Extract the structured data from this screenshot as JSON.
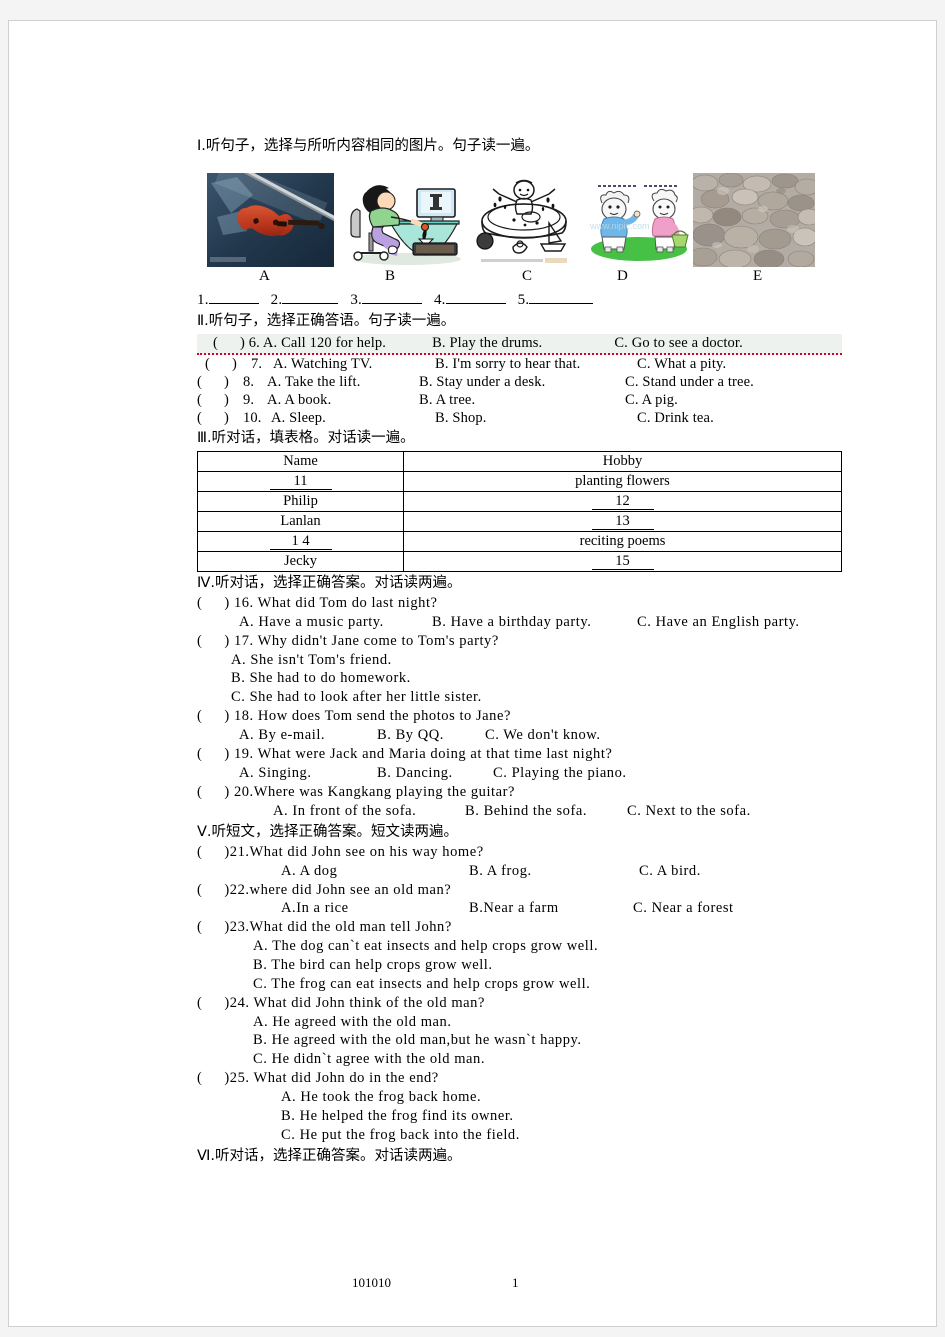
{
  "document": {
    "footer_code": "101010",
    "page_number": "1"
  },
  "sections": {
    "s1": {
      "heading": "Ⅰ.听句子，选择与所听内容相同的图片。句子读一遍。",
      "pictures": [
        {
          "label": "A",
          "alt": "red violin with bow on dark blue background"
        },
        {
          "label": "B",
          "alt": "cartoon girl sitting at a computer desk"
        },
        {
          "label": "C",
          "alt": "line drawing of a child in a swimming pool with ball and toy boat"
        },
        {
          "label": "D",
          "alt": "two cartoon goats on grass, one with a basket"
        },
        {
          "label": "E",
          "alt": "photograph of gray and brown stones"
        }
      ],
      "blanks": [
        "1.",
        "2.",
        "3.",
        "4.",
        "5."
      ]
    },
    "s2": {
      "heading": "Ⅱ.听句子，选择正确答语。句子读一遍。",
      "items": [
        {
          "num": "6.",
          "a": "A. Call 120 for help.",
          "b": "B. Play the drums.",
          "c": "C. Go to see a doctor."
        },
        {
          "num": "7.",
          "a": "A. Watching TV.",
          "b": "B. I'm sorry to hear that.",
          "c": "C. What a pity."
        },
        {
          "num": "8.",
          "a": "A. Take the lift.",
          "b": "B. Stay under a desk.",
          "c": "C. Stand under a tree."
        },
        {
          "num": "9.",
          "a": "A. A book.",
          "b": "B. A tree.",
          "c": "C. A pig."
        },
        {
          "num": "10.",
          "a": "A. Sleep.",
          "b": "B. Shop.",
          "c": "C. Drink tea."
        }
      ]
    },
    "s3": {
      "heading": "Ⅲ.听对话，填表格。对话读一遍。",
      "table": {
        "headers": [
          "Name",
          "Hobby"
        ],
        "rows": [
          {
            "name": "11",
            "name_blank": true,
            "hobby": "planting  flowers",
            "hobby_blank": false
          },
          {
            "name": "Philip",
            "name_blank": false,
            "hobby": "12",
            "hobby_blank": true
          },
          {
            "name": "Lanlan",
            "name_blank": false,
            "hobby": "13",
            "hobby_blank": true
          },
          {
            "name": "1 4",
            "name_blank": true,
            "hobby": "reciting  poems",
            "hobby_blank": false
          },
          {
            "name": "Jecky",
            "name_blank": false,
            "hobby": "15",
            "hobby_blank": true
          }
        ]
      }
    },
    "s4": {
      "heading": "Ⅳ.听对话，选择正确答案。对话读两遍。",
      "q16": {
        "stem": ") 16. What did Tom do last night?",
        "a": "A. Have a music party.",
        "b": "B. Have a birthday party.",
        "c": "C. Have an English party."
      },
      "q17": {
        "stem": ") 17. Why didn't Jane come to Tom's party?",
        "a": "A.  She isn't Tom's friend.",
        "b": "B.  She had to do homework.",
        "c": "C.  She had to look after her little sister."
      },
      "q18": {
        "stem": ") 18. How does Tom send the photos to Jane?",
        "a": "A. By e-mail.",
        "b": "B. By QQ.",
        "c": "C. We don't know."
      },
      "q19": {
        "stem": ") 19. What were Jack and Maria doing at that time last night?",
        "a": "A. Singing.",
        "b": "B. Dancing.",
        "c": "C. Playing the piano."
      },
      "q20": {
        "stem": ") 20.Where was Kangkang playing the guitar?",
        "a": "A. In front of the sofa.",
        "b": "B. Behind the sofa.",
        "c": "C. Next to the sofa."
      }
    },
    "s5": {
      "heading": "Ⅴ.听短文，选择正确答案。短文读两遍。",
      "q21": {
        "stem": ")21.What did John see on his way home?",
        "a": "A. A dog",
        "b": "B. A frog.",
        "c": "C. A bird."
      },
      "q22": {
        "stem": ")22.where did John see an old man?",
        "a": "A.In a rice",
        "b": "B.Near a farm",
        "c": "C. Near a forest"
      },
      "q23": {
        "stem": ")23.What did the old man tell John?",
        "a": "A.  The dog can`t eat insects and help crops grow well.",
        "b": "B.  The bird can help crops grow well.",
        "c": "C.  The frog can eat insects and help crops grow well."
      },
      "q24": {
        "stem": ")24. What did John think of the old man?",
        "a": "A.  He agreed with the old man.",
        "b": "B.  He agreed with the old man,but he wasn`t happy.",
        "c": "C.  He didn`t agree with the old man."
      },
      "q25": {
        "stem": ")25. What did John do in the end?",
        "a": "A.  He took the frog back home.",
        "b": "B.  He helped the frog find its owner.",
        "c": "C.  He put the frog back into the field."
      }
    },
    "s6": {
      "heading": "Ⅵ.听对话，选择正确答案。对话读两遍。"
    }
  }
}
